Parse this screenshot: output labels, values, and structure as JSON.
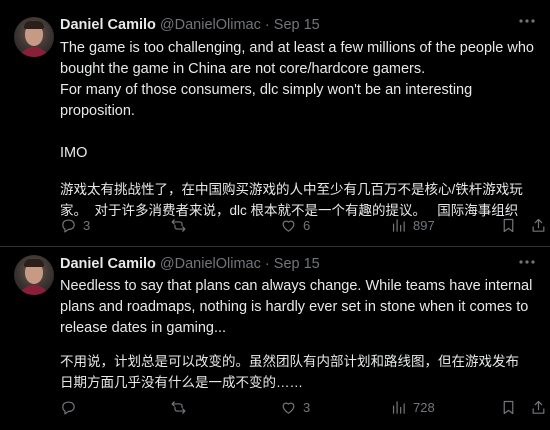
{
  "tweets": [
    {
      "author_name": "Daniel Camilo",
      "handle": "@DanielOlimac",
      "separator": "·",
      "date": "Sep 15",
      "text_lines": [
        "The game is too challenging, and at least a few millions of the people who",
        "bought the game in China are not core/hardcore gamers.",
        "For many of those consumers, dlc simply won't be an interesting",
        "proposition."
      ],
      "signoff": "IMO",
      "translation_lines": [
        "游戏太有挑战性了，在中国购买游戏的人中至少有几百万不是核心/铁杆游戏玩",
        "家。  对于许多消费者来说，dlc 根本就不是一个有趣的提议。   国际海事组织"
      ],
      "actions": {
        "replies": "3",
        "reposts": "",
        "likes": "6",
        "views": "897"
      }
    },
    {
      "author_name": "Daniel Camilo",
      "handle": "@DanielOlimac",
      "separator": "·",
      "date": "Sep 15",
      "text_lines": [
        "Needless to say that plans can always change. While teams have internal",
        "plans and roadmaps, nothing is hardly ever set in stone when it comes to",
        "release dates in gaming..."
      ],
      "translation_lines": [
        "不用说，计划总是可以改变的。虽然团队有内部计划和路线图，但在游戏发布",
        "日期方面几乎没有什么是一成不变的……"
      ],
      "actions": {
        "replies": "",
        "reposts": "",
        "likes": "3",
        "views": "728"
      }
    }
  ],
  "icons": [
    "more-icon",
    "reply-icon",
    "repost-icon",
    "like-icon",
    "views-icon",
    "bookmark-icon",
    "share-icon"
  ],
  "colors": {
    "background": "#000000",
    "text": "#e7e9ea",
    "secondary": "#71767b",
    "divider": "#2f3336"
  }
}
